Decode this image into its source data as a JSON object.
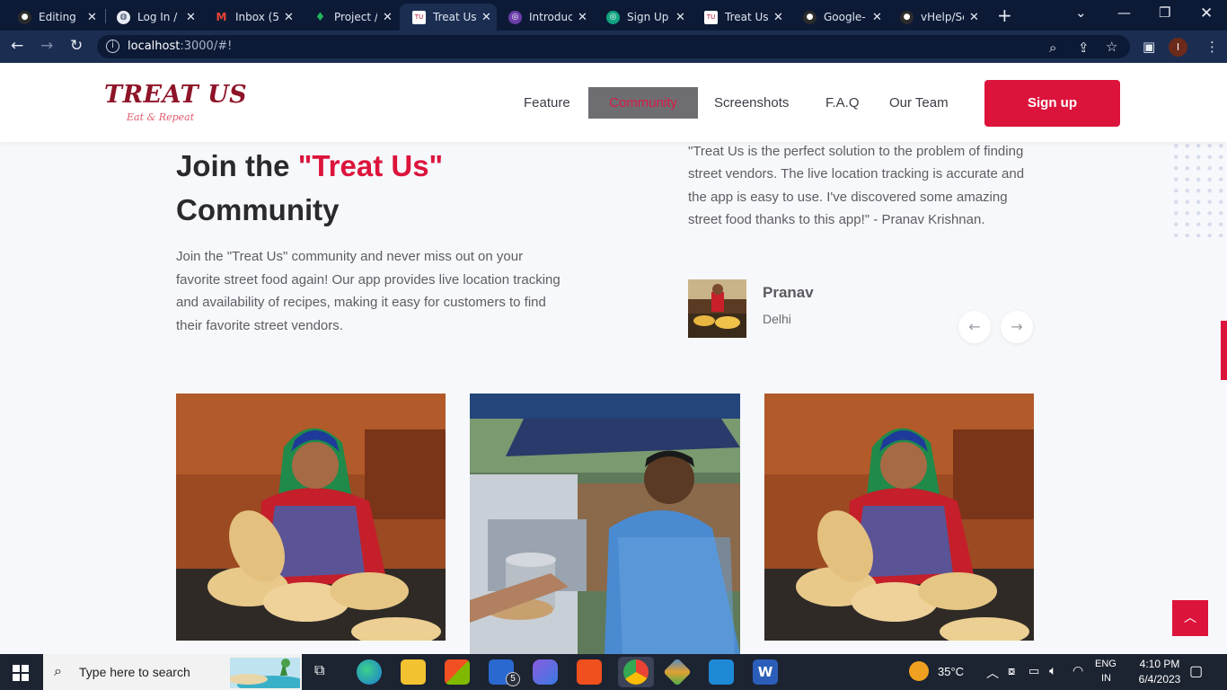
{
  "browser": {
    "tabs": [
      {
        "title": "Editing",
        "icon": "github-icon",
        "color": "#1f1f1f"
      },
      {
        "title": "Log In /",
        "icon": "globe-icon",
        "color": "#3c4a66"
      },
      {
        "title": "Inbox (5",
        "icon": "gmail-icon",
        "color": "#d93025"
      },
      {
        "title": "Project /",
        "icon": "leaf-icon",
        "color": "#1a8c3c"
      },
      {
        "title": "Treat Us",
        "icon": "treatus-icon",
        "color": "#b01030"
      },
      {
        "title": "Introduc",
        "icon": "openai-icon",
        "color": "#6a3ea8"
      },
      {
        "title": "Sign Up",
        "icon": "openai-icon",
        "color": "#10a37f"
      },
      {
        "title": "Treat Us",
        "icon": "treatus-icon",
        "color": "#b01030"
      },
      {
        "title": "Google-",
        "icon": "github-icon",
        "color": "#1f1f1f"
      },
      {
        "title": "vHelp/Sc",
        "icon": "github-icon",
        "color": "#1f1f1f"
      }
    ],
    "active_tab": 4,
    "url_host": "localhost",
    "url_rest": ":3000/#!",
    "profile_initial": "I"
  },
  "site": {
    "logo": "TREAT US",
    "tagline": "Eat & Repeat",
    "nav": [
      "Feature",
      "Community",
      "Screenshots",
      "F.A.Q",
      "Our Team"
    ],
    "nav_active": "Community",
    "signup": "Sign up",
    "accent_color": "#dc143c"
  },
  "community": {
    "title_pre": "Join the ",
    "title_accent": "\"Treat Us\"",
    "title_post": "Community",
    "intro": "Join the \"Treat Us\" community and never miss out on your favorite street food again! Our app provides live location tracking and availability of recipes, making it easy for customers to find their favorite street vendors."
  },
  "testimonial": {
    "quote": "\"Treat Us is the perfect solution to the problem of finding street vendors. The live location tracking is accurate and the app is easy to use. I've discovered some amazing street food thanks to this app!\" - Pranav Krishnan.",
    "name": "Pranav",
    "city": "Delhi"
  },
  "taskbar": {
    "search_placeholder": "Type here to search",
    "mail_badge": "5",
    "weather": "35°C",
    "lang_top": "ENG",
    "lang_bottom": "IN",
    "time": "4:10 PM",
    "date": "6/4/2023"
  }
}
